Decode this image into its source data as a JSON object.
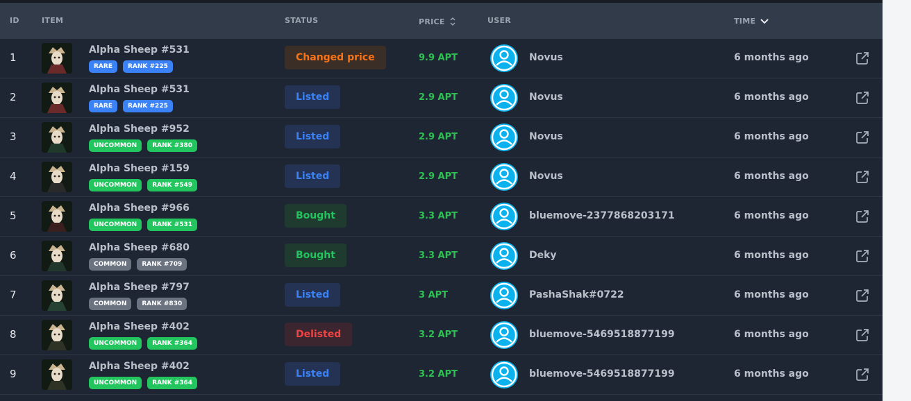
{
  "header": {
    "id": "ID",
    "item": "ITEM",
    "status": "STATUS",
    "price": "PRICE",
    "user": "USER",
    "time": "TIME"
  },
  "colors": {
    "rare": "#3b82f6",
    "uncommon": "#22c55e",
    "common": "#6b7280",
    "changed_text": "#f97316",
    "changed_bg": "#3a2e27",
    "listed_text": "#3b82f6",
    "listed_bg": "#243253",
    "bought_text": "#22c55e",
    "bought_bg": "#1f3b30",
    "delisted_text": "#ef4444",
    "delisted_bg": "#3b2630",
    "price": "#2fbf55",
    "avatar": "#0cb2ee"
  },
  "icons": {
    "sort": "sort-updown-icon",
    "time_sort": "chevron-down-icon",
    "avatar": "user-circle-icon",
    "open": "external-link-icon"
  },
  "rows": [
    {
      "id": "1",
      "name": "Alpha Sheep #531",
      "rarity": "RARE",
      "rarity_type": "rare",
      "rank": "RANK #225",
      "status": "Changed price",
      "status_type": "changed",
      "price": "9.9 APT",
      "user": "Novus",
      "time": "6 months ago"
    },
    {
      "id": "2",
      "name": "Alpha Sheep #531",
      "rarity": "RARE",
      "rarity_type": "rare",
      "rank": "RANK #225",
      "status": "Listed",
      "status_type": "listed",
      "price": "2.9 APT",
      "user": "Novus",
      "time": "6 months ago"
    },
    {
      "id": "3",
      "name": "Alpha Sheep #952",
      "rarity": "UNCOMMON",
      "rarity_type": "uncommon",
      "rank": "RANK #380",
      "status": "Listed",
      "status_type": "listed",
      "price": "2.9 APT",
      "user": "Novus",
      "time": "6 months ago"
    },
    {
      "id": "4",
      "name": "Alpha Sheep #159",
      "rarity": "UNCOMMON",
      "rarity_type": "uncommon",
      "rank": "RANK #549",
      "status": "Listed",
      "status_type": "listed",
      "price": "2.9 APT",
      "user": "Novus",
      "time": "6 months ago"
    },
    {
      "id": "5",
      "name": "Alpha Sheep #966",
      "rarity": "UNCOMMON",
      "rarity_type": "uncommon",
      "rank": "RANK #531",
      "status": "Bought",
      "status_type": "bought",
      "price": "3.3 APT",
      "user": "bluemove-2377868203171",
      "time": "6 months ago"
    },
    {
      "id": "6",
      "name": "Alpha Sheep #680",
      "rarity": "COMMON",
      "rarity_type": "common",
      "rank": "RANK #709",
      "status": "Bought",
      "status_type": "bought",
      "price": "3.3 APT",
      "user": "Deky",
      "time": "6 months ago"
    },
    {
      "id": "7",
      "name": "Alpha Sheep #797",
      "rarity": "COMMON",
      "rarity_type": "common",
      "rank": "RANK #830",
      "status": "Listed",
      "status_type": "listed",
      "price": "3 APT",
      "user": "PashaShak#0722",
      "time": "6 months ago"
    },
    {
      "id": "8",
      "name": "Alpha Sheep #402",
      "rarity": "UNCOMMON",
      "rarity_type": "uncommon",
      "rank": "RANK #364",
      "status": "Delisted",
      "status_type": "delisted",
      "price": "3.2 APT",
      "user": "bluemove-5469518877199",
      "time": "6 months ago"
    },
    {
      "id": "9",
      "name": "Alpha Sheep #402",
      "rarity": "UNCOMMON",
      "rarity_type": "uncommon",
      "rank": "RANK #364",
      "status": "Listed",
      "status_type": "listed",
      "price": "3.2 APT",
      "user": "bluemove-5469518877199",
      "time": "6 months ago"
    }
  ]
}
